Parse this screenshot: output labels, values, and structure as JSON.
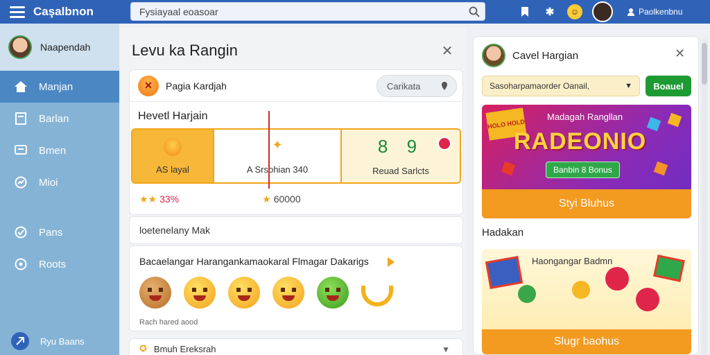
{
  "app": {
    "brand": "Caşalbnon"
  },
  "search": {
    "value": "Fysiayaal eoasoar"
  },
  "header": {
    "user_name": "Paolkenbnu"
  },
  "sidebar": {
    "profile_name": "Naapendah",
    "items": [
      {
        "label": "Manjan",
        "icon": "home-icon",
        "active": true
      },
      {
        "label": "Barlan",
        "icon": "document-icon",
        "active": false
      },
      {
        "label": "Bmen",
        "icon": "message-icon",
        "active": false
      },
      {
        "label": "Mioi",
        "icon": "chart-icon",
        "active": false
      },
      {
        "label": "Pans",
        "icon": "check-icon",
        "active": false
      },
      {
        "label": "Roots",
        "icon": "gear-icon",
        "active": false
      }
    ],
    "bottom_label": "Ryu Baans"
  },
  "main": {
    "title": "Levu ka Rangin",
    "card1": {
      "head_label": "Pagia Kardjah",
      "button_label": "Carikata",
      "subtitle": "Hevetl Harjain",
      "stats": [
        {
          "label": "AS layal"
        },
        {
          "label": "A Srsohian 340"
        },
        {
          "value": "8 9",
          "label": "Reuad Sarlcts"
        }
      ],
      "footer_left": "33%",
      "footer_right": "60000"
    },
    "card2_label": "loetenelany Mak",
    "card3": {
      "title": "Bacaelangar Harangankamaokaral Flmagar Dakarigs",
      "footer": "Rach hared aood"
    },
    "card4_label": "Bmuh Ereksrah"
  },
  "right": {
    "title": "Cavel Hargian",
    "select_value": "Sasoharpamaorder Oanail,",
    "button_label": "Boauel",
    "promo1": {
      "badge": "HOLO HOLD",
      "small": "Madagah Rangllan",
      "big": "RADEONIO",
      "green": "Banbin 8 Bonus",
      "cta": "Styi Bluhus"
    },
    "section_title": "Hadakan",
    "promo2": {
      "title": "Haongangar Badmn",
      "cta": "Slugr baohus"
    }
  },
  "colors": {
    "topbar": "#2f63b8",
    "sidebar": "#85b3d5",
    "accent": "#f39a20",
    "green": "#1e9a33"
  }
}
